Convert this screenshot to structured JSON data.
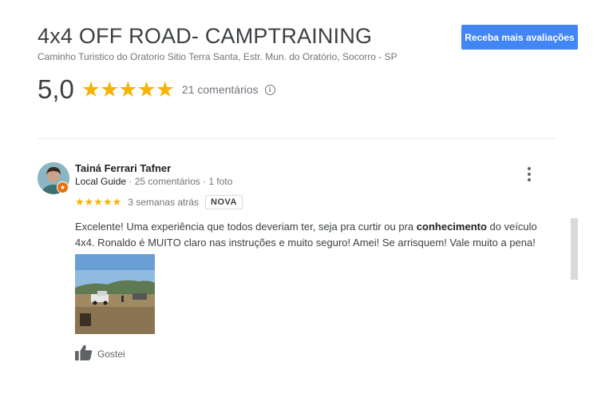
{
  "place": {
    "title": "4x4 OFF ROAD- CAMPTRAINING",
    "address": "Caminho Turistico do Oratorio Sitio Terra Santa, Estr. Mun. do Oratório, Socorro - SP",
    "cta_label": "Receba mais avaliações",
    "rating": "5,0",
    "stars": "★★★★★",
    "reviews_count": "21 comentários",
    "info_icon": "i"
  },
  "review": {
    "author": "Tainá Ferrari Tafner",
    "local_guide": "Local Guide",
    "stats": " · 25 comentários · 1 foto",
    "stars": "★★★★★",
    "date": "3 semanas atrás",
    "badge": "NOVA",
    "text_part1": "Excelente! Uma experiência que todos deveriam ter, seja pra curtir ou pra ",
    "text_bold": "conhecimento",
    "text_part2": " do veículo 4x4. Ronaldo é MUITO claro nas instruções e muito seguro! Amei! Se arrisquem! Vale muito a pena!",
    "like_label": "Gostei"
  },
  "icons": {
    "info": "info-icon",
    "more": "more-vert-icon",
    "like": "thumbs-up-icon",
    "badge": "local-guide-star-icon"
  },
  "colors": {
    "accent": "#4285f4",
    "star": "#f4b400",
    "local_guide_badge": "#e8710a"
  }
}
